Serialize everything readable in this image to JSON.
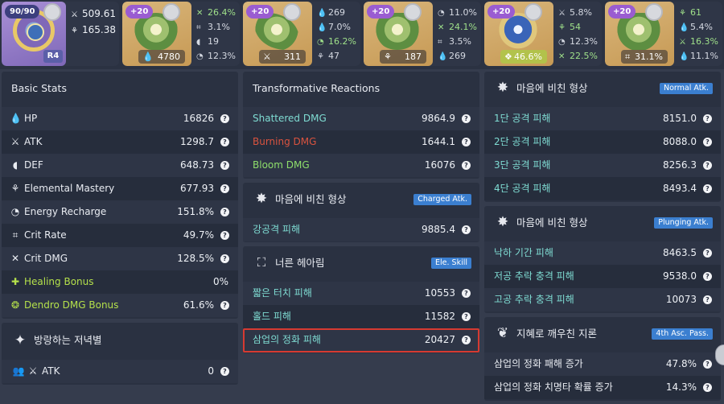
{
  "weapon": {
    "level": "90/90",
    "refine": "R4",
    "atk": "509.61",
    "sub_value": "165.38"
  },
  "artifacts": [
    {
      "level": "+20",
      "main": "4780",
      "main_icon": "hp-icon",
      "subs": [
        {
          "icon": "crit-dmg-icon",
          "value": "26.4%",
          "good": true
        },
        {
          "icon": "crit-rate-icon",
          "value": "3.1%"
        },
        {
          "icon": "def-icon",
          "value": "19"
        },
        {
          "icon": "energy-recharge-icon",
          "value": "12.3%"
        }
      ]
    },
    {
      "level": "+20",
      "main": "311",
      "main_icon": "atk-icon",
      "subs": [
        {
          "icon": "hp-percent-icon",
          "value": "269"
        },
        {
          "icon": "hp-icon",
          "value": "7.0%"
        },
        {
          "icon": "energy-recharge-icon",
          "value": "16.2%",
          "good": true
        },
        {
          "icon": "elemental-mastery-icon",
          "value": "47"
        }
      ]
    },
    {
      "level": "+20",
      "main": "187",
      "main_icon": "elemental-mastery-icon",
      "subs": [
        {
          "icon": "energy-recharge-icon",
          "value": "11.0%"
        },
        {
          "icon": "crit-dmg-icon",
          "value": "24.1%",
          "good": true
        },
        {
          "icon": "crit-rate-icon",
          "value": "3.5%"
        },
        {
          "icon": "hp-icon",
          "value": "269"
        }
      ]
    },
    {
      "level": "+20",
      "main": "46.6%",
      "main_icon": "dendro-icon",
      "subs": [
        {
          "icon": "atk-icon",
          "value": "5.8%"
        },
        {
          "icon": "elemental-mastery-icon",
          "value": "54",
          "good": true
        },
        {
          "icon": "energy-recharge-icon",
          "value": "12.3%"
        },
        {
          "icon": "crit-dmg-icon",
          "value": "22.5%",
          "good": true
        }
      ]
    },
    {
      "level": "+20",
      "main": "31.1%",
      "main_icon": "crit-rate-icon",
      "subs": [
        {
          "icon": "elemental-mastery-icon",
          "value": "61",
          "good": true
        },
        {
          "icon": "hp-icon",
          "value": "5.4%"
        },
        {
          "icon": "atk-icon",
          "value": "16.3%",
          "good": true
        },
        {
          "icon": "hp-percent-icon",
          "value": "11.1%"
        }
      ]
    }
  ],
  "basic_stats": {
    "title": "Basic Stats",
    "rows": [
      {
        "label": "HP",
        "value": "16826"
      },
      {
        "label": "ATK",
        "value": "1298.7"
      },
      {
        "label": "DEF",
        "value": "648.73"
      },
      {
        "label": "Elemental Mastery",
        "value": "677.93"
      },
      {
        "label": "Energy Recharge",
        "value": "151.8%"
      },
      {
        "label": "Crit Rate",
        "value": "49.7%"
      },
      {
        "label": "Crit DMG",
        "value": "128.5%"
      },
      {
        "label": "Healing Bonus",
        "value": "0%"
      },
      {
        "label": "Dendro DMG Bonus",
        "value": "61.6%"
      }
    ]
  },
  "wanderer_panel": {
    "title": "방랑하는 저녁별",
    "rows": [
      {
        "label": "ATK",
        "value": "0"
      }
    ]
  },
  "transformative": {
    "title": "Transformative Reactions",
    "rows": [
      {
        "label": "Shattered DMG",
        "value": "9864.9"
      },
      {
        "label": "Burning DMG",
        "value": "1644.1"
      },
      {
        "label": "Bloom DMG",
        "value": "16076"
      }
    ]
  },
  "charged_panel": {
    "title": "마음에 비친 형상",
    "badge": "Charged Atk.",
    "rows": [
      {
        "label": "강공격 피해",
        "value": "9885.4"
      }
    ]
  },
  "skill_panel": {
    "title": "너른 헤아림",
    "badge": "Ele. Skill",
    "rows": [
      {
        "label": "짧은 터치 피해",
        "value": "10553"
      },
      {
        "label": "홀드 피해",
        "value": "11582"
      },
      {
        "label": "삼업의 정화 피해",
        "value": "20427"
      }
    ]
  },
  "normal_panel": {
    "title": "마음에 비친 형상",
    "badge": "Normal Atk.",
    "rows": [
      {
        "label": "1단 공격 피해",
        "value": "8151.0"
      },
      {
        "label": "2단 공격 피해",
        "value": "8088.0"
      },
      {
        "label": "3단 공격 피해",
        "value": "8256.3"
      },
      {
        "label": "4단 공격 피해",
        "value": "8493.4"
      }
    ]
  },
  "plunging_panel": {
    "title": "마음에 비친 형상",
    "badge": "Plunging Atk.",
    "rows": [
      {
        "label": "낙하 기간 피해",
        "value": "8463.5"
      },
      {
        "label": "저공 추락 충격 피해",
        "value": "9538.0"
      },
      {
        "label": "고공 추락 충격 피해",
        "value": "10073"
      }
    ]
  },
  "passive_panel": {
    "title": "지혜로 깨우친 지론",
    "badge": "4th Asc. Pass.",
    "rows": [
      {
        "label": "삼업의 정화 패해 증가",
        "value": "47.8%"
      },
      {
        "label": "삼업의 정화 치명타 확률 증가",
        "value": "14.3%"
      }
    ]
  },
  "colors": {
    "background": "#353c4d",
    "panel": "#2a3141",
    "badge": "#3b7fd0",
    "highlight": "#d63a31",
    "teal_text": "#7fdcd3",
    "pyro_text": "#d9533f",
    "dendro_text": "#8ede6b",
    "healing_text": "#b4e04b"
  }
}
